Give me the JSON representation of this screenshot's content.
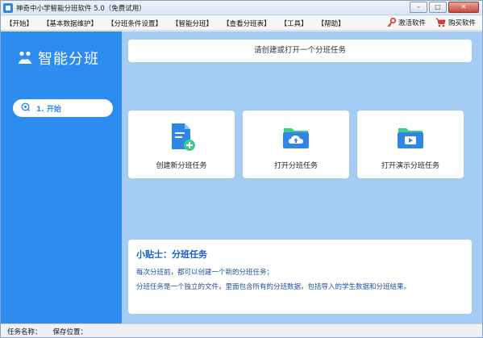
{
  "window": {
    "title": "神奇中小学智能分班软件 5.0（免费试用）",
    "controls": {
      "minimize": "–",
      "maximize": "□",
      "close": "✕"
    }
  },
  "menu": {
    "items": [
      {
        "label": "【开始】"
      },
      {
        "label": "【基本数据维护】"
      },
      {
        "label": "【分班条件设置】"
      },
      {
        "label": "【智能分班】"
      },
      {
        "label": "【查看分班表】"
      },
      {
        "label": "【工具】"
      },
      {
        "label": "【帮助】"
      }
    ],
    "activate_label": "激活软件",
    "buy_label": "购买软件"
  },
  "sidebar": {
    "brand": "智能分班",
    "nav_items": [
      {
        "label": "1. 开始"
      }
    ]
  },
  "main": {
    "prompt": "请创建或打开一个分班任务",
    "cards": [
      {
        "label": "创建新分班任务",
        "icon": "new-file-icon"
      },
      {
        "label": "打开分班任务",
        "icon": "cloud-folder-icon"
      },
      {
        "label": "打开演示分班任务",
        "icon": "play-folder-icon"
      }
    ],
    "tip": {
      "title": "小贴士：分班任务",
      "lines": [
        "每次分班前，都可以创建一个新的分班任务；",
        "分班任务是一个独立的文件，里面包含所有的分班数据，包括导入的学生数据和分班结果。"
      ]
    }
  },
  "status": {
    "task_name_label": "任务名称：",
    "save_location_label": "保存位置："
  },
  "colors": {
    "sidebar": "#2d8cf0",
    "main_bg": "#a3cbf3",
    "tip_title": "#1a5fc8",
    "icon_blue": "#2f86e6",
    "icon_green": "#3fcc8f"
  }
}
